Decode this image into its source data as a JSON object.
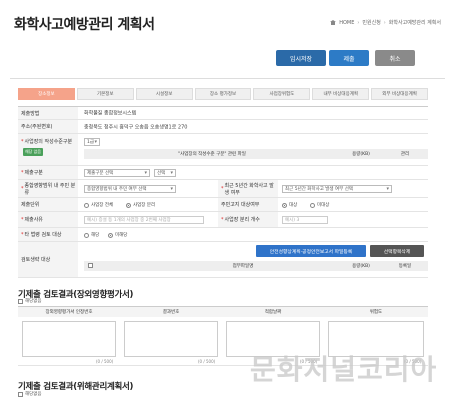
{
  "header": {
    "title": "화학사고예방관리 계획서",
    "breadcrumb": [
      "HOME",
      "민원신청",
      "화학사고예방관리 계획서"
    ]
  },
  "actions": {
    "temp_save": "임시저장",
    "submit": "제출",
    "cancel": "취소"
  },
  "tabs": [
    {
      "label": "장소정보",
      "active": true
    },
    {
      "label": "기본정보",
      "active": false
    },
    {
      "label": "시설정보",
      "active": false
    },
    {
      "label": "장소 평가정보",
      "active": false
    },
    {
      "label": "사업장위험도",
      "active": false
    },
    {
      "label": "내부 비상대응계획",
      "active": false
    },
    {
      "label": "외부 비상대응계획",
      "active": false
    }
  ],
  "form": {
    "company_label": "제출방법",
    "company_value": "화학물질 종합정보시스템",
    "address_label": "주소(주된변호)",
    "address_value": "충청북도 청주시 흥덕구 오송읍 오송생명1로 270",
    "reason_label": "사업장의 작성수준구분",
    "reason_tag": "해당 없음",
    "reason_select": "1급",
    "file_label": "\"사업장의 작성수준 구분\" 관련 파일",
    "file_col_capacity": "용량(KB)",
    "file_col_manage": "관리",
    "submit_type_label": "제출구분",
    "submit_type_select": "제출구분 선택",
    "submit_type_select2": "선택",
    "chem_label": "종합영향범위 내 주민 분류",
    "chem_select": "종합영향범위 내 주민 여부 선택",
    "recent_label": "최근 5년간 화학사고 발생 여부",
    "recent_select": "최근 5년간 화학사고 발생 여부 선택",
    "target_label": "제출단위",
    "target_opt1": "사업장 전체",
    "target_opt2": "사업장 분리",
    "resident_label": "주민고지 대상여부",
    "resident_opt1": "대상",
    "resident_opt2": "미대상",
    "name_label": "제출사유",
    "name_placeholder": "예시) 증설 등 1개의 사업장 중 2번째 사업장",
    "separate_label": "사업장 분리 개수",
    "separate_placeholder": "예시) 3",
    "law_label": "타 법령 검토 대상",
    "law_opt1": "해당",
    "law_opt2": "미해당",
    "review_label": "검토생략 대상",
    "review_btn1": "안전성향상계획·공정안전보고서 파일등록",
    "review_btn2": "선택항목삭제",
    "review_col_file": "첨부파일명",
    "review_col_capacity": "용량(KB)",
    "review_col_reg": "등록일"
  },
  "section1": {
    "title": "기제출 검토결과(장외영향평가서)",
    "sub": "해당없음",
    "cols": [
      "장외영향평가서 인정번호",
      "결과번호",
      "적합날짜",
      "위험도"
    ],
    "counter": "(0 / 500)"
  },
  "section2": {
    "title": "기제출 검토결과(위해관리계획서)",
    "sub": "해당없음"
  },
  "watermark": "문화저널코리아"
}
